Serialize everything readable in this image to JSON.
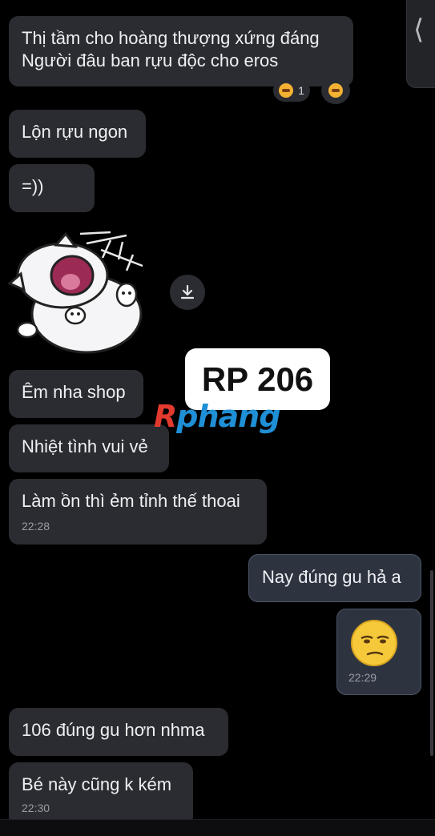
{
  "messages": {
    "m1": {
      "lines": [
        "Thị tầm cho hoàng thượng xứng đáng",
        "Người đâu ban rựu độc cho eros"
      ]
    },
    "m1_reaction_count": "1",
    "m2": "Lộn rựu ngon",
    "m3": "=))",
    "m4": "Êm nha shop",
    "m5": "Nhiệt tình vui vẻ",
    "m6": {
      "text": "Làm ồn thì ẻm tỉnh thế thoai",
      "time": "22:28"
    },
    "m7": "Nay đúng gu hả a",
    "m8": {
      "time": "22:29"
    },
    "m9": "106 đúng gu hơn nhma",
    "m10": {
      "text": "Bé này cũng k kém",
      "time": "22:30"
    }
  },
  "overlay": {
    "label": "RP 206",
    "watermark_a": "R",
    "watermark_b": "phang",
    "watermark_colors": {
      "a": "#e23a2e",
      "b": "#1f8fd6"
    }
  },
  "icons": {
    "side_tab": "chevron-left-icon",
    "download": "download-icon",
    "reaction": "laughing-emoji-icon",
    "sticker": "cat-sticker",
    "emoji": "smirk-emoji-icon"
  },
  "colors": {
    "background": "#000000",
    "incoming_bubble": "#2b2c31",
    "outgoing_bubble": "#2d3440",
    "text": "#eef0f3",
    "timestamp": "#9a9ca3"
  }
}
